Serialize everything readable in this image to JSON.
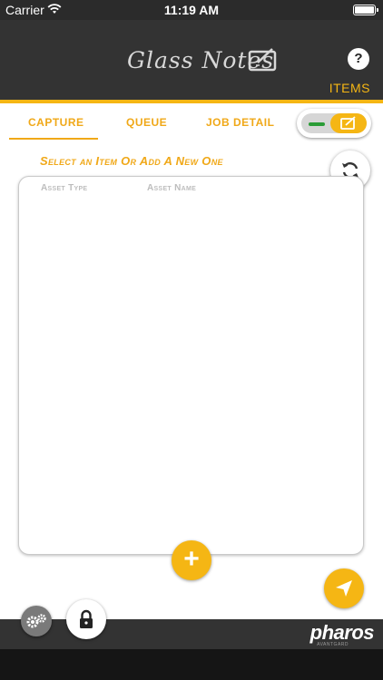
{
  "status_bar": {
    "carrier": "Carrier",
    "time": "11:19 AM"
  },
  "header": {
    "app_name": "Glass Notes",
    "help_label": "?",
    "items_label": "ITEMS"
  },
  "tabs": [
    {
      "label": "CAPTURE",
      "active": true
    },
    {
      "label": "QUEUE",
      "active": false
    },
    {
      "label": "JOB DETAIL",
      "active": false
    }
  ],
  "main": {
    "section_title": "Select an Item Or Add A New One",
    "columns": [
      "Asset Type",
      "Asset Name"
    ],
    "add_label": "+"
  },
  "footer": {
    "brand": "pharos",
    "brand_sub": "AVANTGARD"
  },
  "colors": {
    "accent": "#f5b614",
    "header_bg": "#333333",
    "toggle_green": "#2a9c36"
  },
  "icons": [
    "wifi-icon",
    "battery-icon",
    "tablet-edit-icon",
    "help-icon",
    "refresh-icon",
    "send-icon",
    "settings-icon",
    "lock-icon"
  ]
}
